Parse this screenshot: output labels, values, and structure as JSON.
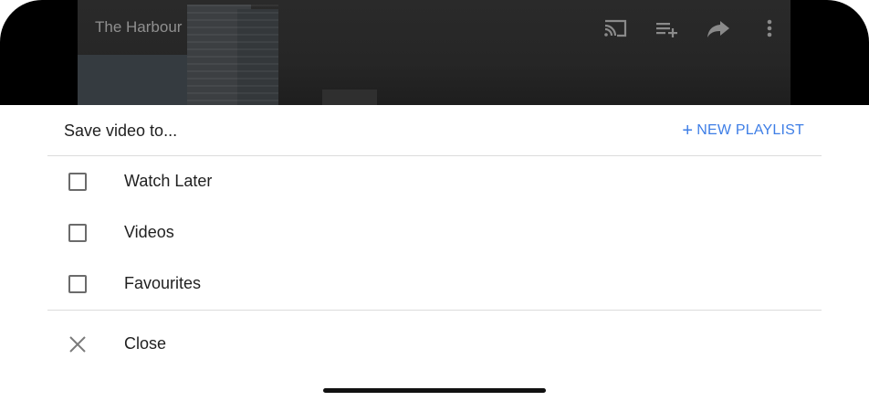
{
  "video": {
    "title": "The Harbour",
    "icons": [
      "cast-icon",
      "add-to-queue-icon",
      "share-icon",
      "more-vert-icon"
    ]
  },
  "sheet": {
    "title": "Save video to...",
    "new_playlist_label": "NEW PLAYLIST",
    "new_playlist_plus": "+",
    "accent_color": "#3e7ee6"
  },
  "playlists": [
    {
      "label": "Watch Later",
      "checked": false
    },
    {
      "label": "Videos",
      "checked": false
    },
    {
      "label": "Favourites",
      "checked": false
    }
  ],
  "close_label": "Close"
}
